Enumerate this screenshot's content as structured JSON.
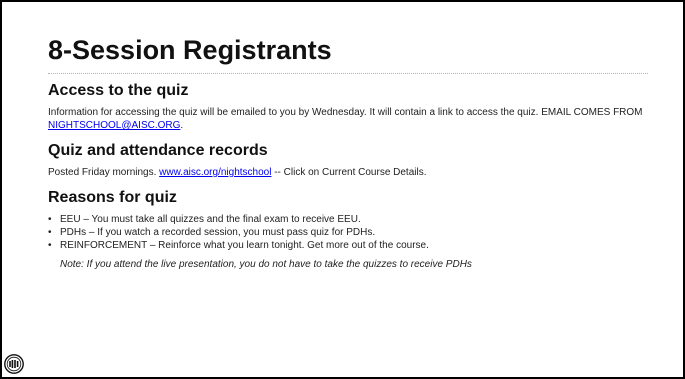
{
  "slide": {
    "title": "8-Session Registrants",
    "sections": {
      "access": {
        "heading": "Access to the quiz",
        "text_before_link": "Information for accessing the quiz will be emailed to you by Wednesday.  It will contain a link to access the quiz.  EMAIL COMES FROM ",
        "email_link": "NIGHTSCHOOL@AISC.ORG",
        "text_after_link": "."
      },
      "records": {
        "heading": "Quiz and attendance records",
        "text_before_link": "Posted Friday mornings.  ",
        "url_link": "www.aisc.org/nightschool",
        "text_after_link": " -- Click on Current Course Details."
      },
      "reasons": {
        "heading": "Reasons for quiz",
        "bullets": [
          "EEU – You must take all quizzes and the final exam to receive EEU.",
          "PDHs – If you watch a recorded session, you must pass quiz for PDHs.",
          "REINFORCEMENT – Reinforce what you learn tonight.  Get more out of the course."
        ],
        "bullet_symbol": "•",
        "note": "Note:  If you attend the live presentation, you do not have to take the quizzes to receive PDHs"
      }
    },
    "logo_icon": "aisc-logo-icon",
    "link_color": "#0000ee"
  }
}
